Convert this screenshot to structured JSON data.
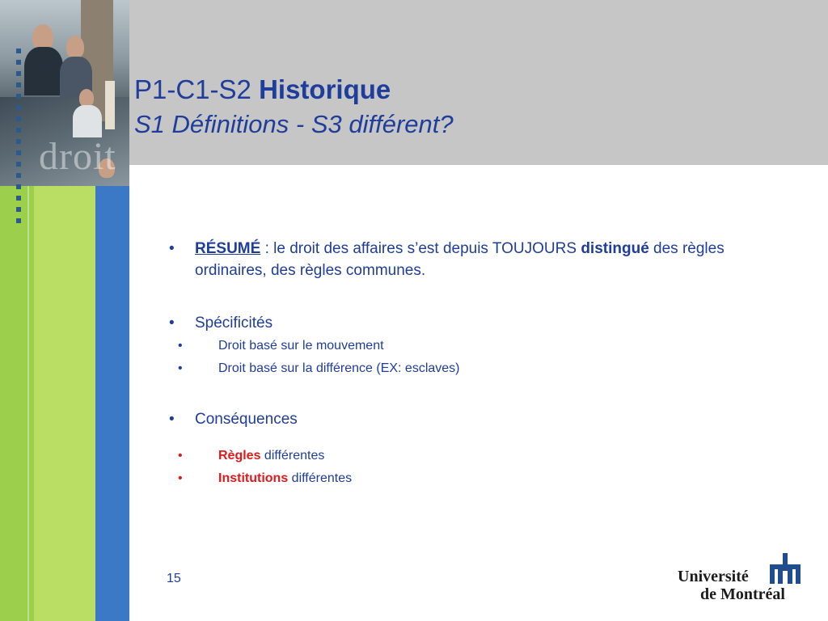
{
  "header": {
    "title_prefix": "P1-C1-S2",
    "title_bold": "Historique",
    "subtitle": "S1 Définitions - S3 différent?"
  },
  "side": {
    "watermark_word": "droit"
  },
  "content": {
    "item1": {
      "label": "RÉSUMÉ",
      "text_a": " : le droit des affaires s’est depuis TOUJOURS ",
      "emphasis": "distingué",
      "text_b": " des règles ordinaires, des règles communes."
    },
    "item2": {
      "label": "Spécificités",
      "subitems": [
        "Droit basé sur le mouvement",
        "Droit basé sur la différence (EX: esclaves)"
      ]
    },
    "item3": {
      "label": "Conséquences",
      "subitems": [
        {
          "bold": "Règles",
          "rest": " différentes"
        },
        {
          "bold": "Institutions",
          "rest": " différentes"
        }
      ]
    }
  },
  "footer": {
    "page_number": "15",
    "logo_line1": "Université",
    "logo_line2": "de Montréal"
  },
  "colors": {
    "title_blue": "#1f3d9a",
    "accent_red": "#e0191b",
    "header_gray": "#c6c6c6",
    "sidebar_green": "#9ccf4b",
    "sidebar_blue": "#3b78c6"
  }
}
